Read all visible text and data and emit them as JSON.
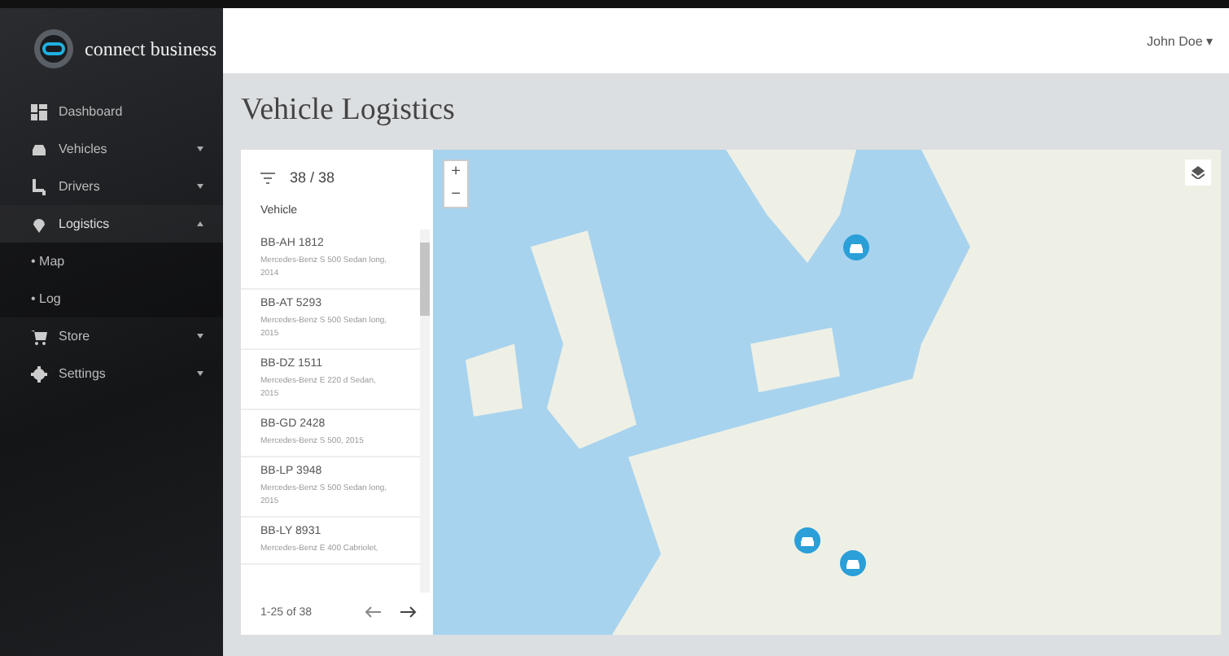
{
  "brand": {
    "name": "connect business"
  },
  "header": {
    "user": "John Doe ▾"
  },
  "page": {
    "title": "Vehicle Logistics"
  },
  "sidebar": {
    "items": [
      {
        "label": "Dashboard",
        "kind": "dashboard",
        "has_caret": false,
        "expanded": false
      },
      {
        "label": "Vehicles",
        "kind": "car",
        "has_caret": true,
        "expanded": false
      },
      {
        "label": "Drivers",
        "kind": "seat",
        "has_caret": true,
        "expanded": false
      },
      {
        "label": "Logistics",
        "kind": "pin",
        "has_caret": true,
        "expanded": true,
        "children": [
          {
            "label": "• Map"
          },
          {
            "label": "• Log"
          }
        ]
      },
      {
        "label": "Store",
        "kind": "cart",
        "has_caret": true,
        "expanded": false
      },
      {
        "label": "Settings",
        "kind": "gear",
        "has_caret": true,
        "expanded": false
      }
    ]
  },
  "vehicle_list": {
    "count": "38 / 38",
    "column": "Vehicle",
    "pagination": "1-25 of 38",
    "rows": [
      {
        "plate": "BB-AH 1812",
        "model": "Mercedes-Benz S 500 Sedan long, 2014"
      },
      {
        "plate": "BB-AT 5293",
        "model": "Mercedes-Benz S 500 Sedan long, 2015"
      },
      {
        "plate": "BB-DZ 1511",
        "model": "Mercedes-Benz E 220 d Sedan, 2015"
      },
      {
        "plate": "BB-GD 2428",
        "model": "Mercedes-Benz S 500, 2015"
      },
      {
        "plate": "BB-LP 3948",
        "model": "Mercedes-Benz S 500 Sedan long, 2015"
      },
      {
        "plate": "BB-LY 8931",
        "model": "Mercedes-Benz E 400 Cabriolet,"
      }
    ]
  },
  "map": {
    "zoom_in": "+",
    "zoom_out": "−"
  }
}
